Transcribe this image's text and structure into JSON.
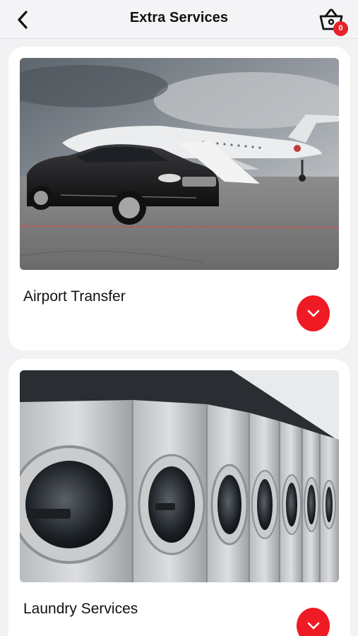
{
  "header": {
    "title": "Extra Services",
    "cart_count": "0",
    "back_icon": "chevron-left-icon",
    "cart_icon": "basket-icon"
  },
  "services": [
    {
      "title": "Airport Transfer",
      "image": "black sedan in front of private jet on tarmac"
    },
    {
      "title": "Laundry Services",
      "image": "row of stainless steel washing machines"
    }
  ],
  "colors": {
    "accent": "#ef1b24",
    "badge": "#e8222a",
    "background": "#f2f2f4",
    "card": "#ffffff"
  }
}
